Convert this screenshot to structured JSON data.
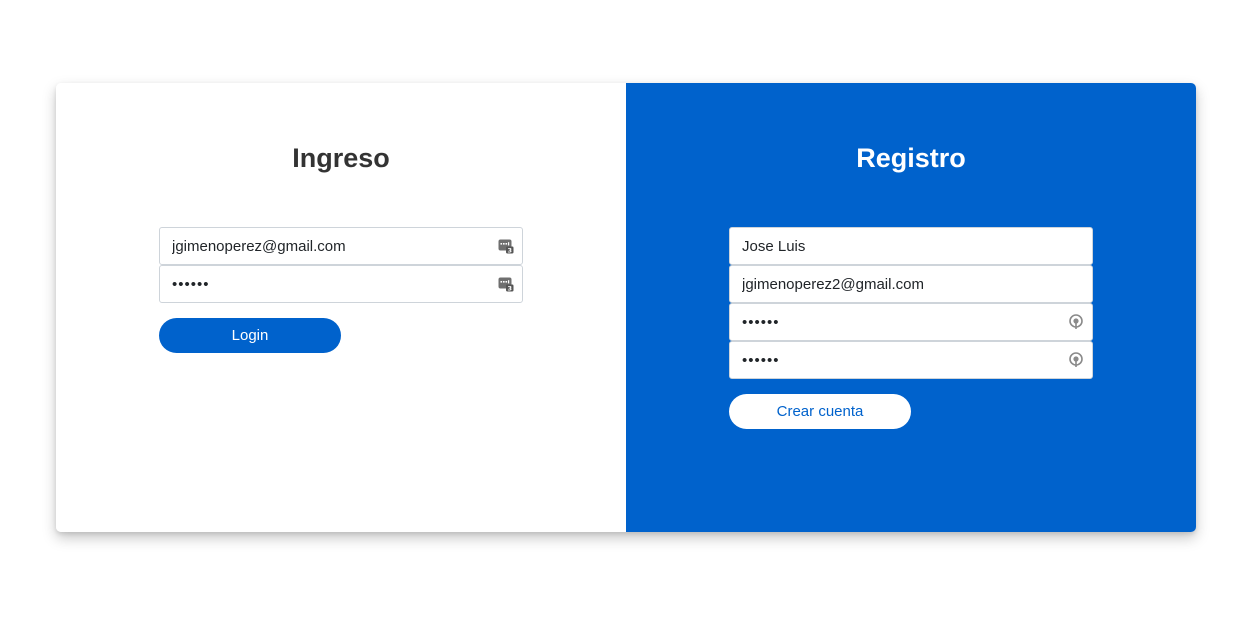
{
  "login": {
    "title": "Ingreso",
    "email_value": "jgimenoperez@gmail.com",
    "password_value": "123456",
    "submit_label": "Login"
  },
  "register": {
    "title": "Registro",
    "name_value": "Jose Luis",
    "email_value": "jgimenoperez2@gmail.com",
    "password_value": "123456",
    "password_confirm_value": "123456",
    "submit_label": "Crear cuenta"
  },
  "colors": {
    "primary": "#0062cc",
    "title_dark": "#333333",
    "white": "#ffffff"
  },
  "icons": {
    "login_email_field": "password-manager-key-icon",
    "login_password_field": "password-manager-key-icon",
    "register_password_fields": "password-generator-icon"
  }
}
